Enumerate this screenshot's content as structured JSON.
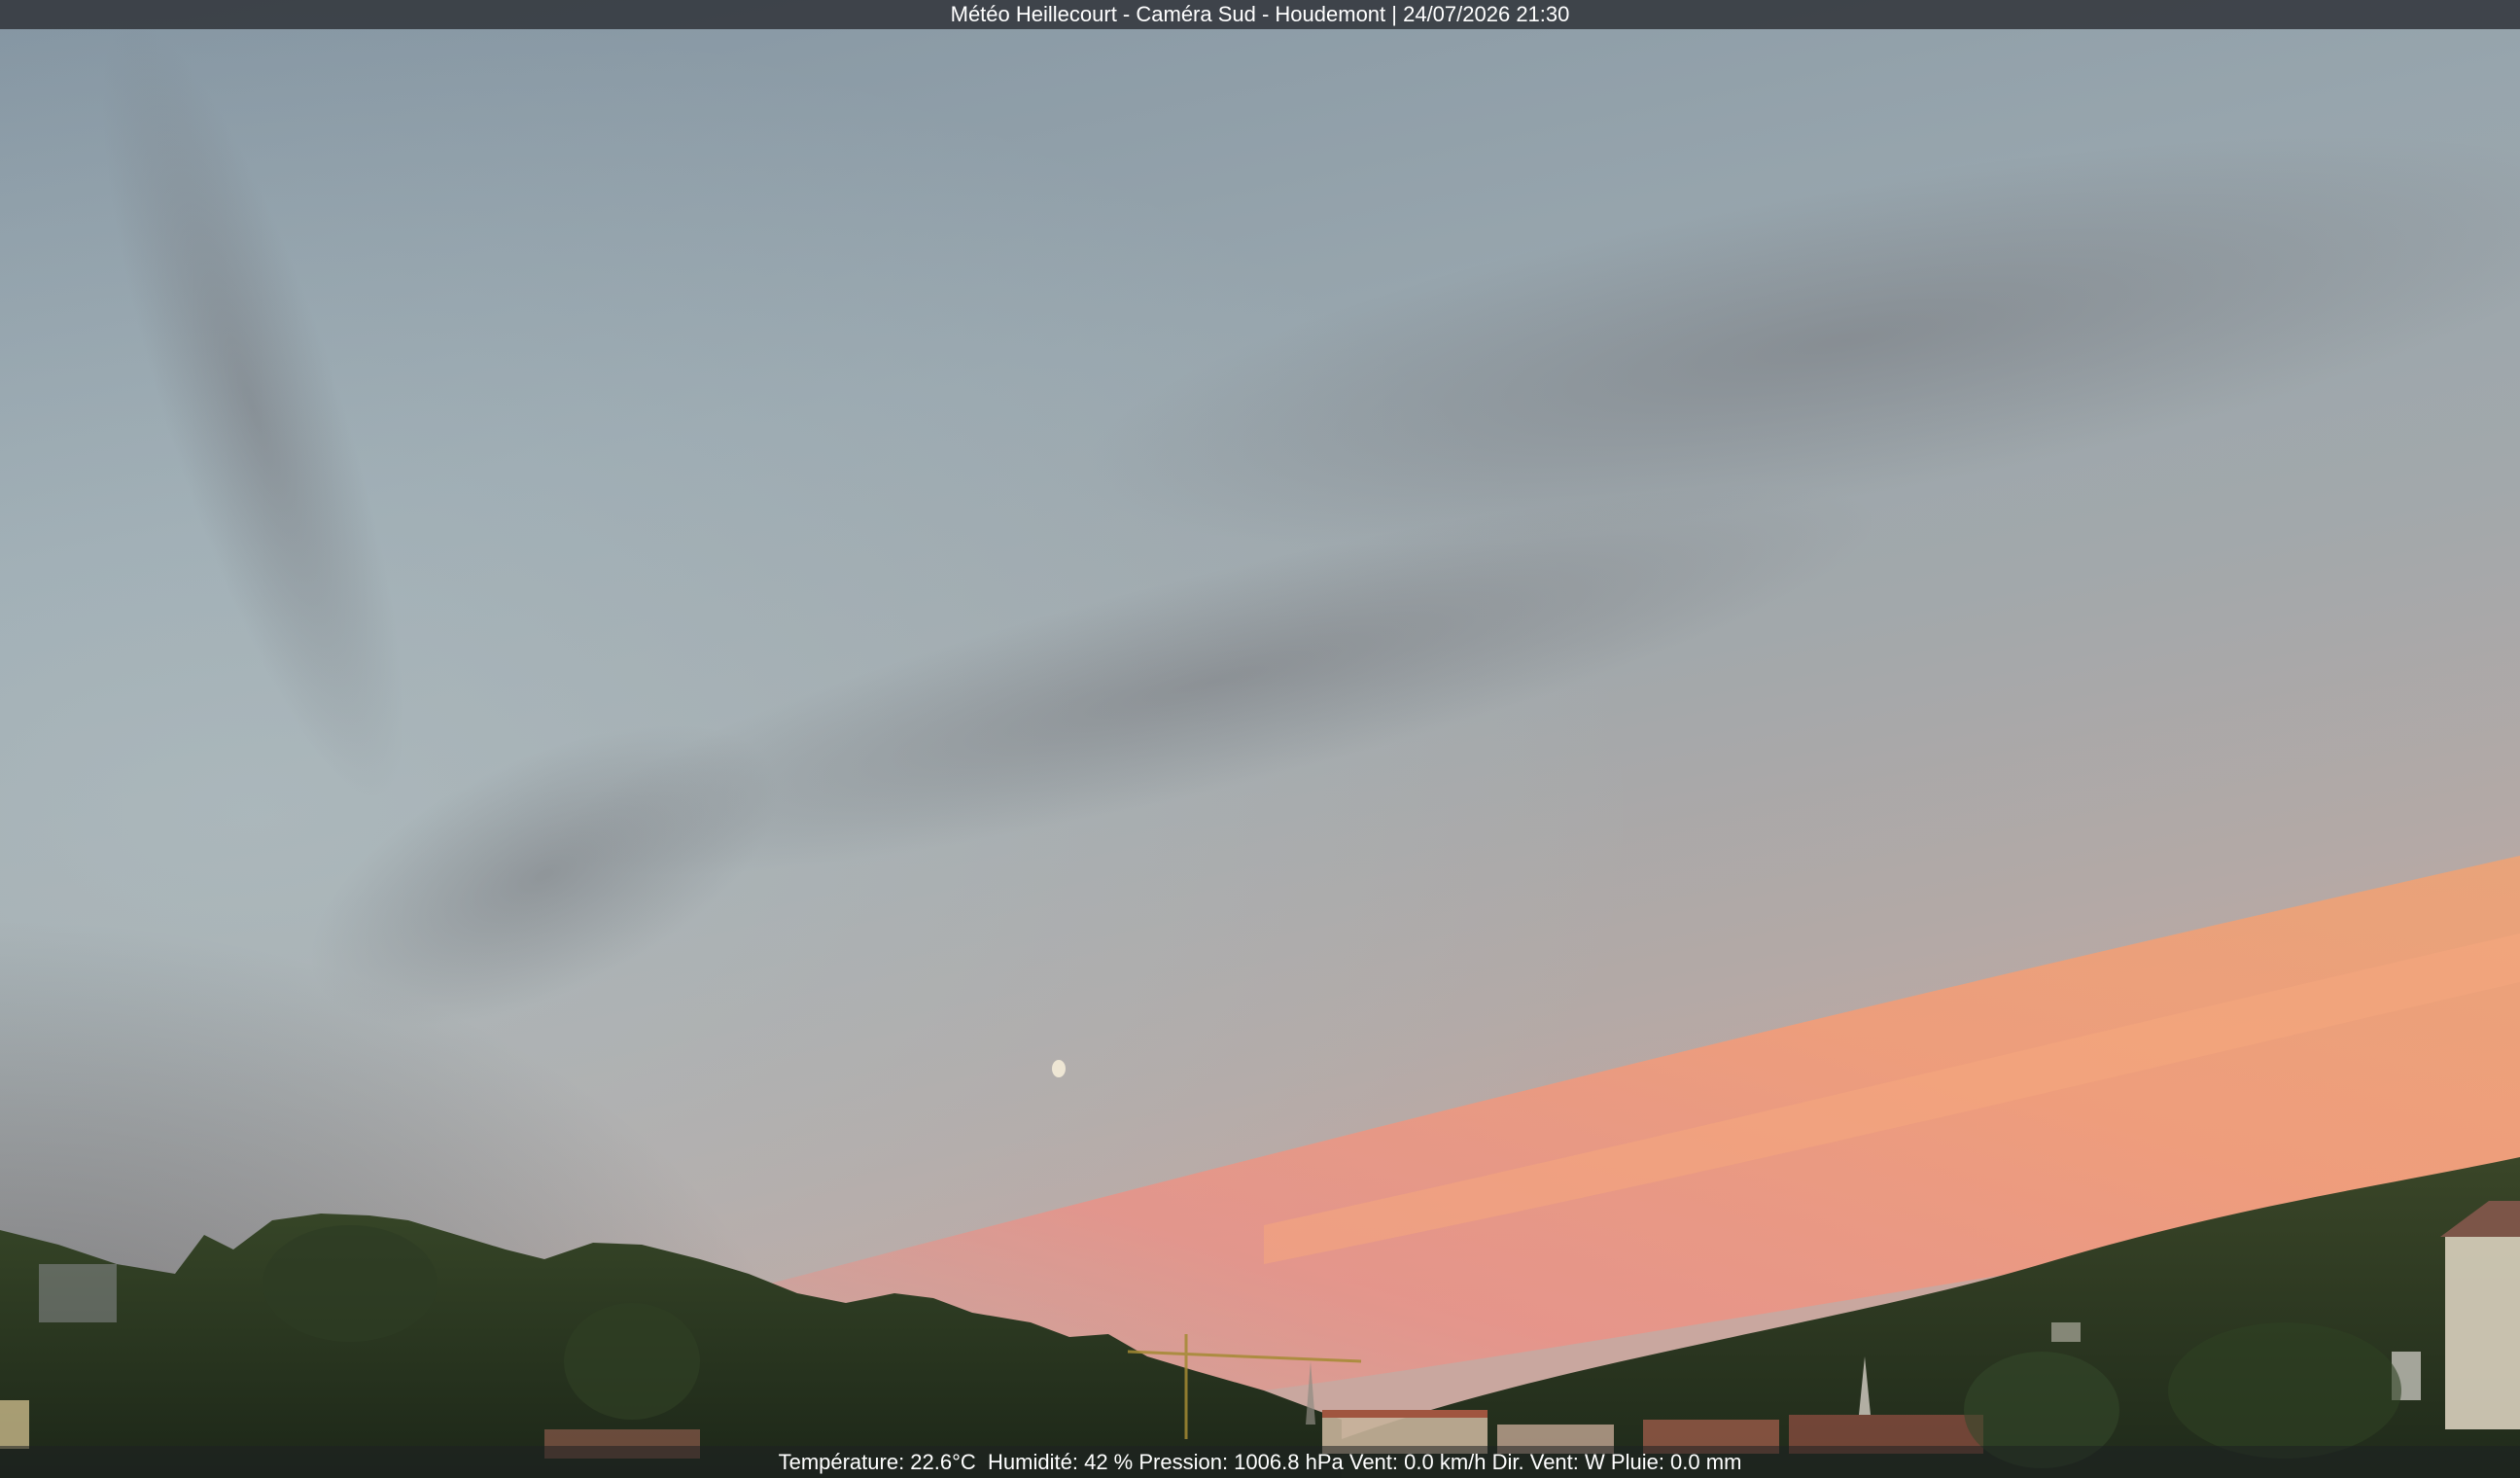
{
  "header": {
    "title": "Météo Heillecourt - Caméra Sud - Houdemont | 24/07/2026 21:30"
  },
  "footer": {
    "temperature": "Température: 22.6°C",
    "humidity": "Humidité: 42 %",
    "pressure": "Pression: 1006.8 hPa",
    "wind_speed": "Vent: 0.0 km/h",
    "wind_direction": "Dir. Vent: W",
    "rain": "Pluie: 0.0 mm"
  },
  "colors": {
    "sky_top": "#8b9aa6",
    "sky_mid": "#a4aeb3",
    "sunset_pink": "#e8957f",
    "sunset_orange": "#f0a57a",
    "trees_dark": "#26331f",
    "trees_mid": "#3b4a2c"
  }
}
